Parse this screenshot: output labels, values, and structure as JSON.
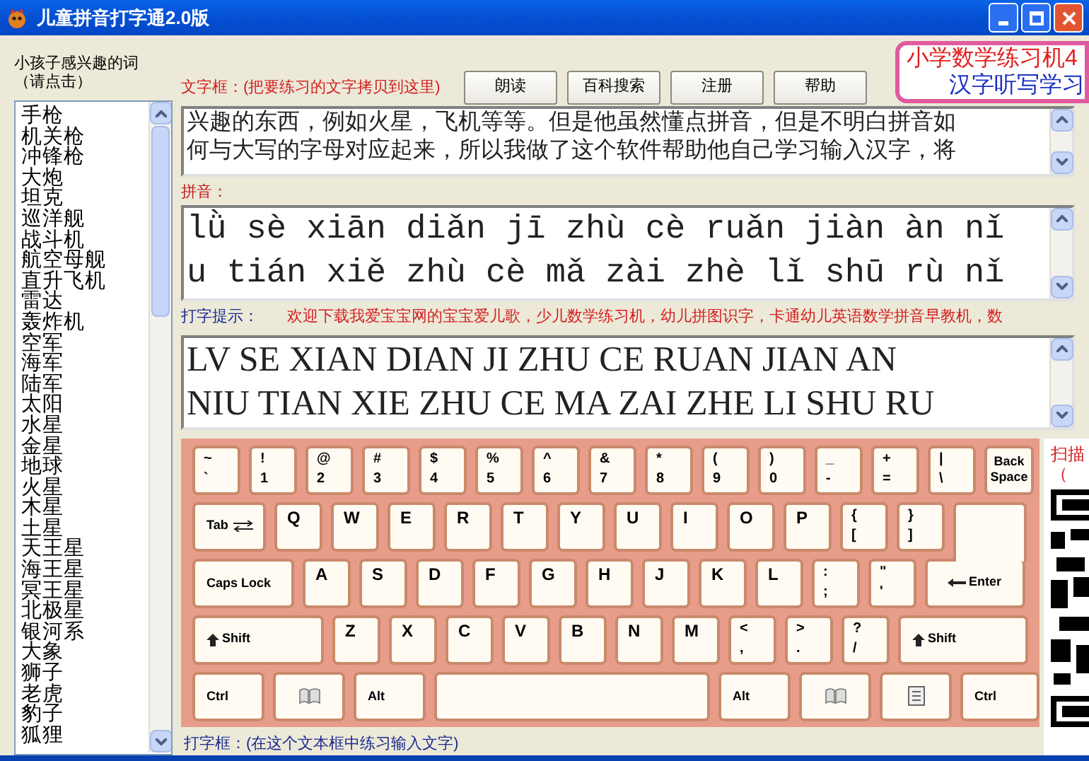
{
  "window": {
    "title": "儿童拼音打字通2.0版"
  },
  "word_list": {
    "label": "小孩子感兴趣的词",
    "hint": "（请点击）",
    "items": [
      "手枪",
      "机关枪",
      "冲锋枪",
      "大炮",
      "坦克",
      "巡洋舰",
      "战斗机",
      "航空母舰",
      "直升飞机",
      "雷达",
      "轰炸机",
      "空军",
      "海军",
      "陆军",
      "太阳",
      "水星",
      "金星",
      "地球",
      "火星",
      "木星",
      "土星",
      "天王星",
      "海王星",
      "冥王星",
      "北极星",
      "银河系",
      "大象",
      "狮子",
      "老虎",
      "豹子",
      "狐狸"
    ]
  },
  "text_box": {
    "label": "文字框：(把要练习的文字拷贝到这里)",
    "lines": [
      "兴趣的东西，例如火星，飞机等等。但是他虽然懂点拼音，但是不明白拼音如",
      "何与大写的字母对应起来，所以我做了这个软件帮助他自己学习输入汉字，将"
    ]
  },
  "buttons": [
    "朗读",
    "百科搜索",
    "注册",
    "帮助"
  ],
  "banner": {
    "lines": [
      "小学数学练习机4",
      "汉字听写学习"
    ]
  },
  "pinyin": {
    "label": "拼音：",
    "lines": [
      "lǜ sè xiān diǎn jī zhù cè ruǎn jiàn àn nǐ",
      "u tián xiě zhù cè mǎ zài zhè lǐ shū rù nǐ"
    ]
  },
  "typing_hint": {
    "label": "打字提示：",
    "marquee": "欢迎下载我爱宝宝网的宝宝爱儿歌，少儿数学练习机，幼儿拼图识字，卡通幼儿英语数学拼音早教机，数",
    "lines": [
      "LV SE XIAN DIAN JI ZHU CE RUAN JIAN AN",
      "NIU TIAN XIE ZHU CE MA ZAI ZHE LI SHU RU"
    ]
  },
  "keyboard": {
    "rows": [
      {
        "keys": [
          {
            "kind": "dual",
            "upper": "~",
            "lower": "`"
          },
          {
            "kind": "dual",
            "upper": "!",
            "lower": "1"
          },
          {
            "kind": "dual",
            "upper": "@",
            "lower": "2"
          },
          {
            "kind": "dual",
            "upper": "#",
            "lower": "3"
          },
          {
            "kind": "dual",
            "upper": "$",
            "lower": "4"
          },
          {
            "kind": "dual",
            "upper": "%",
            "lower": "5"
          },
          {
            "kind": "dual",
            "upper": "^",
            "lower": "6"
          },
          {
            "kind": "dual",
            "upper": "&",
            "lower": "7"
          },
          {
            "kind": "dual",
            "upper": "*",
            "lower": "8"
          },
          {
            "kind": "dual",
            "upper": "(",
            "lower": "9"
          },
          {
            "kind": "dual",
            "upper": ")",
            "lower": "0"
          },
          {
            "kind": "dual",
            "upper": "_",
            "lower": "-"
          },
          {
            "kind": "dual",
            "upper": "+",
            "lower": "="
          },
          {
            "kind": "dual",
            "upper": "|",
            "lower": "\\"
          },
          {
            "kind": "text",
            "label": "Back Space"
          }
        ]
      },
      {
        "keys": [
          {
            "kind": "tab",
            "label": "Tab"
          },
          {
            "kind": "letter",
            "label": "Q"
          },
          {
            "kind": "letter",
            "label": "W"
          },
          {
            "kind": "letter",
            "label": "E"
          },
          {
            "kind": "letter",
            "label": "R"
          },
          {
            "kind": "letter",
            "label": "T"
          },
          {
            "kind": "letter",
            "label": "Y"
          },
          {
            "kind": "letter",
            "label": "U"
          },
          {
            "kind": "letter",
            "label": "I"
          },
          {
            "kind": "letter",
            "label": "O"
          },
          {
            "kind": "letter",
            "label": "P"
          },
          {
            "kind": "dual",
            "upper": "{",
            "lower": "["
          },
          {
            "kind": "dual",
            "upper": "}",
            "lower": "]"
          },
          {
            "kind": "enter-upper"
          }
        ]
      },
      {
        "keys": [
          {
            "kind": "text",
            "label": "Caps Lock"
          },
          {
            "kind": "letter",
            "label": "A"
          },
          {
            "kind": "letter",
            "label": "S"
          },
          {
            "kind": "letter",
            "label": "D"
          },
          {
            "kind": "letter",
            "label": "F"
          },
          {
            "kind": "letter",
            "label": "G"
          },
          {
            "kind": "letter",
            "label": "H"
          },
          {
            "kind": "letter",
            "label": "J"
          },
          {
            "kind": "letter",
            "label": "K"
          },
          {
            "kind": "letter",
            "label": "L"
          },
          {
            "kind": "dual",
            "upper": ":",
            "lower": ";"
          },
          {
            "kind": "dual",
            "upper": "\"",
            "lower": "'"
          },
          {
            "kind": "enter",
            "label": "Enter"
          }
        ]
      },
      {
        "keys": [
          {
            "kind": "shift",
            "label": "Shift"
          },
          {
            "kind": "letter",
            "label": "Z"
          },
          {
            "kind": "letter",
            "label": "X"
          },
          {
            "kind": "letter",
            "label": "C"
          },
          {
            "kind": "letter",
            "label": "V"
          },
          {
            "kind": "letter",
            "label": "B"
          },
          {
            "kind": "letter",
            "label": "N"
          },
          {
            "kind": "letter",
            "label": "M"
          },
          {
            "kind": "dual",
            "upper": "<",
            "lower": ","
          },
          {
            "kind": "dual",
            "upper": ">",
            "lower": "."
          },
          {
            "kind": "dual",
            "upper": "?",
            "lower": "/"
          },
          {
            "kind": "shift",
            "label": "Shift"
          }
        ]
      },
      {
        "keys": [
          {
            "kind": "text",
            "label": "Ctrl"
          },
          {
            "kind": "win"
          },
          {
            "kind": "text",
            "label": "Alt"
          },
          {
            "kind": "space"
          },
          {
            "kind": "text",
            "label": "Alt"
          },
          {
            "kind": "win"
          },
          {
            "kind": "menu"
          },
          {
            "kind": "text",
            "label": "Ctrl"
          }
        ]
      }
    ]
  },
  "typing_box": {
    "label": "打字框：(在这个文本框中练习输入文字)"
  },
  "side_panel": {
    "texts": [
      "扫描",
      "（"
    ]
  }
}
